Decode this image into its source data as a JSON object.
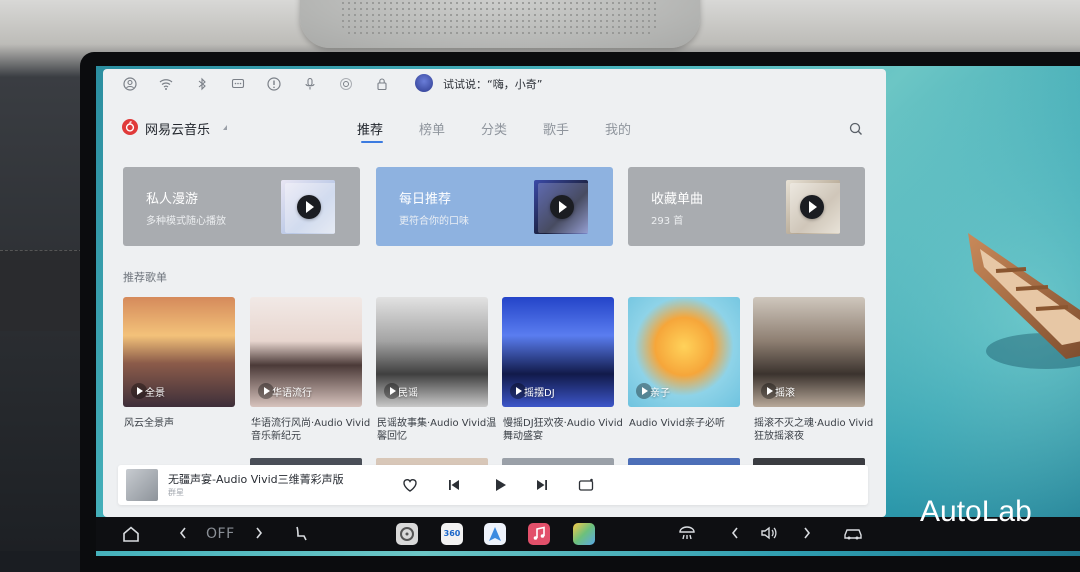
{
  "status_bar": {
    "icons": [
      "user-icon",
      "wifi-icon",
      "bluetooth-icon",
      "message-icon",
      "alert-icon",
      "microphone-icon",
      "hotspot-icon",
      "lock-icon"
    ],
    "voice_prompt": "试试说：“嗨，小奇”"
  },
  "app": {
    "name": "网易云音乐",
    "tabs": [
      "推荐",
      "榜单",
      "分类",
      "歌手",
      "我的"
    ],
    "active_tab": "推荐"
  },
  "cards": [
    {
      "title": "私人漫游",
      "subtitle": "多种模式随心播放"
    },
    {
      "title": "每日推荐",
      "subtitle": "更符合你的口味"
    },
    {
      "title": "收藏单曲",
      "subtitle": "293 首"
    }
  ],
  "section_title": "推荐歌单",
  "playlists": [
    {
      "label": "全景",
      "title": "风云全景声"
    },
    {
      "label": "华语流行",
      "title": "华语流行风尚·Audio Vivid音乐新纪元"
    },
    {
      "label": "民谣",
      "title": "民谣故事集·Audio Vivid温馨回忆"
    },
    {
      "label": "摇摆DJ",
      "title": "慢摇DJ狂欢夜·Audio Vivid舞动盛宴"
    },
    {
      "label": "亲子",
      "title": "Audio Vivid亲子必听"
    },
    {
      "label": "摇滚",
      "title": "摇滚不灭之魂·Audio Vivid狂放摇滚夜"
    }
  ],
  "player": {
    "song": "无疆声宴-Audio Vivid三维菁彩声版",
    "artist": "群星"
  },
  "dock": {
    "off_label": "OFF",
    "app_360_label": "360"
  },
  "watermark": "AutoLab",
  "colors": {
    "accent": "#3c7be0",
    "panel_bg": "#eef0f2",
    "logo_red": "#e03a3a",
    "card_blue": "#8eb2e0",
    "card_gray": "#a9acb0"
  }
}
